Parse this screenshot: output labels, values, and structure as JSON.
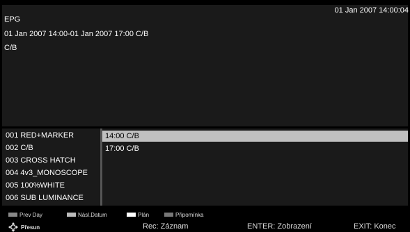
{
  "header": {
    "title": "EPG",
    "datetime": "01 Jan 2007 14:00:04"
  },
  "program_info": {
    "time_range": "01 Jan 2007 14:00-01 Jan 2007 17:00 C/B",
    "description": "C/B"
  },
  "channels": [
    {
      "number": "001",
      "name": "RED+MARKER",
      "label": "001  RED+MARKER"
    },
    {
      "number": "002",
      "name": "C/B",
      "label": "002  C/B"
    },
    {
      "number": "003",
      "name": "CROSS HATCH",
      "label": "003  CROSS HATCH"
    },
    {
      "number": "004",
      "name": "4v3_MONOSCOPE",
      "label": "004  4v3_MONOSCOPE"
    },
    {
      "number": "005",
      "name": "100%WHITE",
      "label": "005  100%WHITE"
    },
    {
      "number": "006",
      "name": "SUB LUMINANCE",
      "label": "006  SUB LUMINANCE"
    }
  ],
  "programs": [
    {
      "label": "14:00 C/B",
      "selected": true
    },
    {
      "label": "17:00 C/B",
      "selected": false
    }
  ],
  "color_keys": [
    {
      "label": "Prev Day",
      "color": "#ff0000"
    },
    {
      "label": "Násl.Datum",
      "color": "#00c000"
    },
    {
      "label": "Plán",
      "color": "#ffff00"
    },
    {
      "label": "Připomínka",
      "color": "#0000ff"
    }
  ],
  "hints": {
    "move": "Přesun",
    "rec": "Rec: Záznam",
    "enter": "ENTER: Zobrazení",
    "exit": "EXIT: Konec"
  },
  "icons": {
    "move": "four-way-arrow-icon"
  }
}
